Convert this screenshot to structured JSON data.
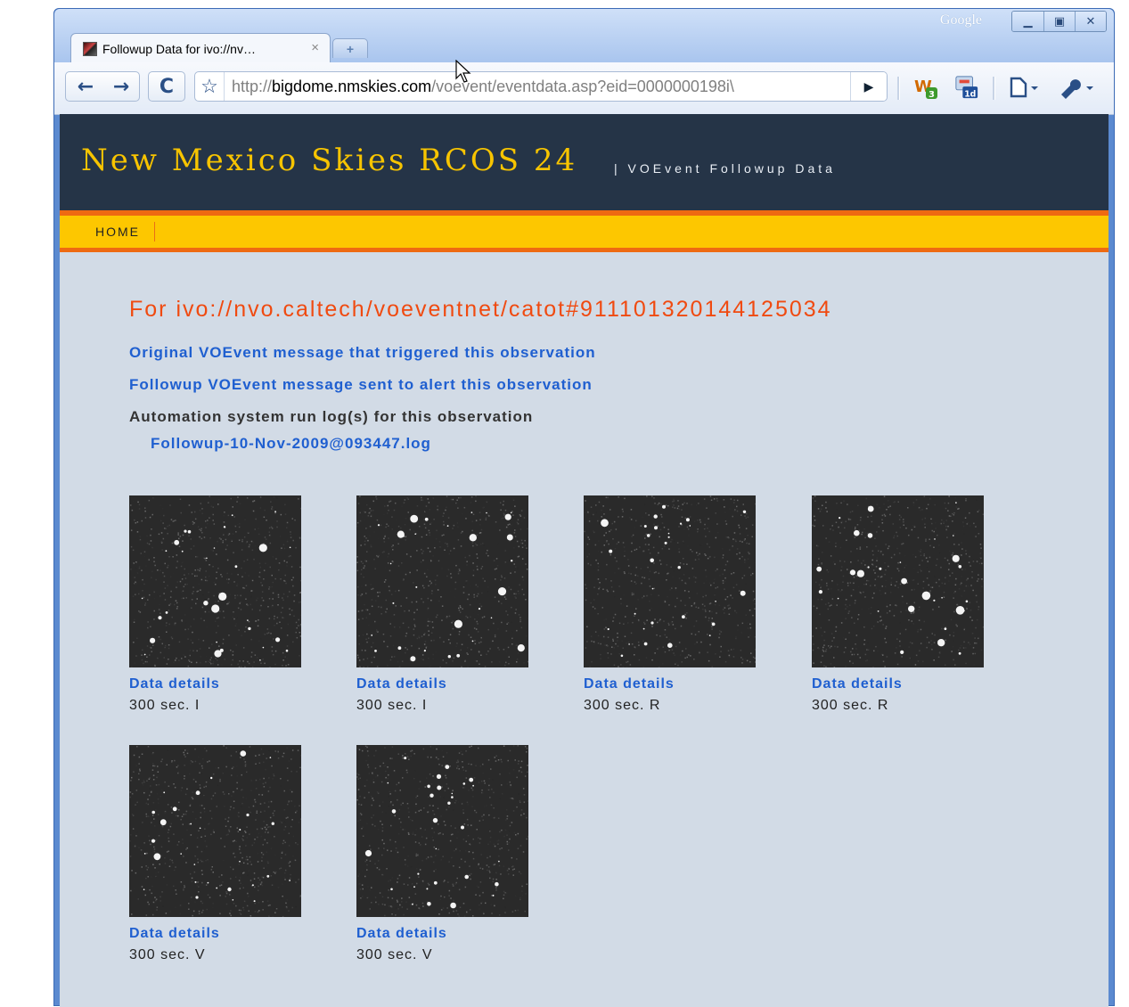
{
  "browser": {
    "tab_title": "Followup Data for ivo://nv…",
    "tab_close": "×",
    "new_tab": "+",
    "brand": "Google",
    "url_host_prefix": "http://",
    "url_host": "bigdome.nmskies.com",
    "url_path": "/voevent/eventdata.asp?eid=0000000198i\\",
    "ext1_badge": "3",
    "ext2_badge": "1d"
  },
  "site": {
    "title": "New Mexico Skies RCOS 24",
    "tagline": "| VOEvent Followup Data",
    "nav_home": "HOME"
  },
  "content": {
    "heading": "For ivo://nvo.caltech/voeventnet/catot#911101320144125034",
    "link_original": "Original VOEvent message that triggered this observation",
    "link_followup": "Followup VOEvent message sent to alert this observation",
    "log_label": "Automation system run log(s) for this observation",
    "log_link": "Followup-10-Nov-2009@093447.log"
  },
  "images": [
    {
      "link": "Data details",
      "caption": "300 sec. I"
    },
    {
      "link": "Data details",
      "caption": "300 sec. I"
    },
    {
      "link": "Data details",
      "caption": "300 sec. R"
    },
    {
      "link": "Data details",
      "caption": "300 sec. R"
    },
    {
      "link": "Data details",
      "caption": "300 sec. V"
    },
    {
      "link": "Data details",
      "caption": "300 sec. V"
    }
  ],
  "colors": {
    "header_bg": "#253447",
    "title_gold": "#f7c400",
    "nav_yellow": "#fdc700",
    "accent_orange": "#ee6a12",
    "heading_orange": "#f04a10",
    "link_blue": "#1f5fd0",
    "page_bg": "#d2dbe6"
  }
}
